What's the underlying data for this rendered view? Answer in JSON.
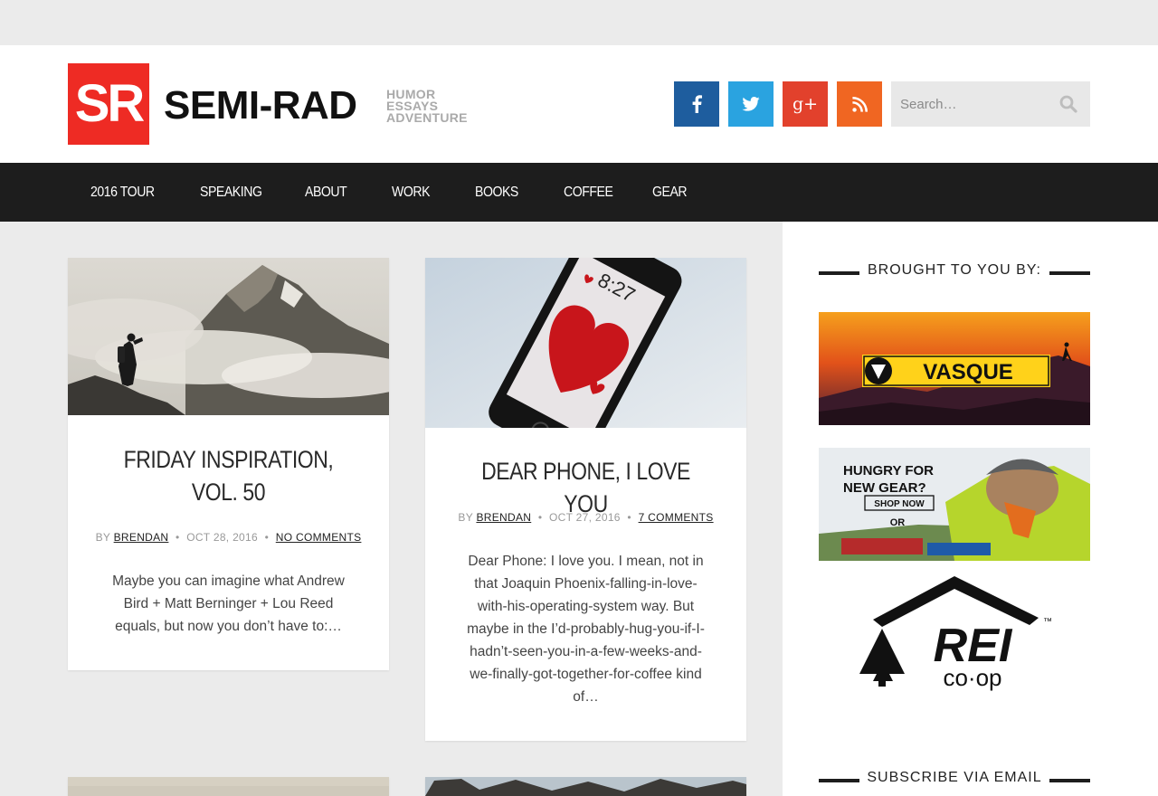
{
  "header": {
    "logo_mark": "SR",
    "logo_word": "SEMI-RAD",
    "logo_tagline": [
      "HUMOR",
      "ESSAYS",
      "ADVENTURE"
    ],
    "brand_color": "#ee2b24",
    "social": [
      {
        "name": "facebook",
        "glyph": "f",
        "color": "#1e5d9e"
      },
      {
        "name": "twitter",
        "glyph": "🐦",
        "color": "#2aa3e0"
      },
      {
        "name": "google-plus",
        "glyph": "g+",
        "color": "#e2412c"
      },
      {
        "name": "rss",
        "glyph": "rss",
        "color": "#f06622"
      }
    ],
    "search_placeholder": "Search…"
  },
  "nav": {
    "items": [
      "2016 TOUR",
      "SPEAKING",
      "ABOUT",
      "WORK",
      "BOOKS",
      "COFFEE",
      "GEAR"
    ]
  },
  "posts": [
    {
      "title": "FRIDAY INSPIRATION, VOL. 50",
      "by": "BY",
      "author": "BRENDAN",
      "date": "OCT 28, 2016",
      "comments": "NO COMMENTS",
      "excerpt": "Maybe you can imagine what Andrew Bird + Matt Berninger + Lou Reed equals, but now you don’t have to:…"
    },
    {
      "title": "DEAR PHONE, I LOVE YOU",
      "by": "BY",
      "author": "BRENDAN",
      "date": "OCT 27, 2016",
      "comments": "7 COMMENTS",
      "excerpt": "Dear Phone: I love you. I mean, not in that Joaquin Phoenix-falling-in-love-with-his-operating-system way. But maybe in the I’d-probably-hug-you-if-I-hadn’t-seen-you-in-a-few-weeks-and-we-finally-got-together-for-coffee kind of…",
      "phone_time": "8:27"
    }
  ],
  "sidebar": {
    "sponsors_title": "BROUGHT TO YOU BY:",
    "subscribe_title": "SUBSCRIBE VIA EMAIL",
    "vasque": "VASQUE",
    "or_ad": {
      "line1": "HUNGRY FOR",
      "line2": "NEW GEAR?",
      "cta": "SHOP NOW",
      "logo": "OR"
    },
    "rei": {
      "word": "REI",
      "coop": "co·op",
      "tm": "™"
    }
  }
}
